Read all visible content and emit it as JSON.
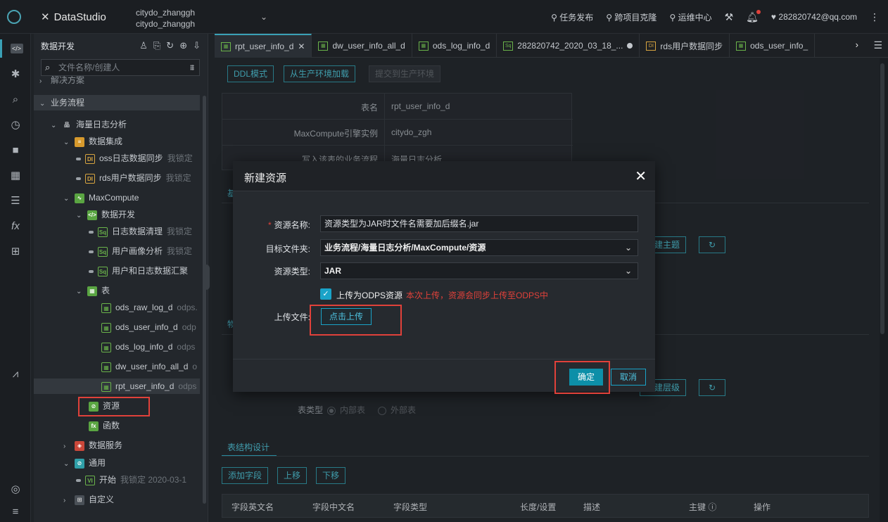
{
  "topbar": {
    "brand": "DataStudio",
    "user_line1": "citydo_zhanggh",
    "user_line2": "citydo_zhanggh",
    "nav": [
      "任务发布",
      "跨项目克隆",
      "运维中心"
    ],
    "account": "282820742@qq.com"
  },
  "sidebar": {
    "title": "数据开发",
    "search_placeholder": "文件名称/创建人",
    "rows": [
      {
        "label": "解决方案"
      },
      {
        "label": "业务流程"
      },
      {
        "label": "海量日志分析"
      },
      {
        "label": "数据集成"
      },
      {
        "icon": "DI",
        "label": "oss日志数据同步",
        "meta": "我锁定"
      },
      {
        "icon": "DI",
        "label": "rds用户数据同步",
        "meta": "我锁定"
      },
      {
        "label": "MaxCompute"
      },
      {
        "label": "数据开发"
      },
      {
        "icon": "Sq",
        "label": "日志数据清理",
        "meta": "我锁定"
      },
      {
        "icon": "Sq",
        "label": "用户画像分析",
        "meta": "我锁定"
      },
      {
        "icon": "Sq",
        "label": "用户和日志数据汇聚"
      },
      {
        "label": "表"
      },
      {
        "label": "ods_raw_log_d",
        "meta": "odps."
      },
      {
        "label": "ods_user_info_d",
        "meta": "odp"
      },
      {
        "label": "ods_log_info_d",
        "meta": "odps"
      },
      {
        "label": "dw_user_info_all_d",
        "meta": "o"
      },
      {
        "label": "rpt_user_info_d",
        "meta": "odps"
      },
      {
        "label": "资源"
      },
      {
        "label": "函数"
      },
      {
        "label": "数据服务"
      },
      {
        "label": "通用"
      },
      {
        "icon": "VI",
        "label": "开始",
        "meta": "我锁定 2020-03-1"
      },
      {
        "label": "自定义"
      }
    ]
  },
  "tabs": [
    {
      "label": "rpt_user_info_d",
      "icon": "table"
    },
    {
      "label": "dw_user_info_all_d",
      "icon": "table"
    },
    {
      "label": "ods_log_info_d",
      "icon": "table"
    },
    {
      "label": "282820742_2020_03_18_...",
      "icon": "Sq"
    },
    {
      "label": "rds用户数据同步",
      "icon": "DI"
    },
    {
      "label": "ods_user_info_",
      "icon": "table"
    }
  ],
  "editor": {
    "btn_ddl": "DDL模式",
    "btn_load": "从生产环境加载",
    "btn_submit": "提交到生产环境",
    "info": [
      {
        "label": "表名",
        "value": "rpt_user_info_d"
      },
      {
        "label": "MaxCompute引擎实例",
        "value": "citydo_zgh"
      },
      {
        "label": "写入该表的业务流程",
        "value": "海量日志分析"
      }
    ],
    "new_topic": "新建主题",
    "new_level": "新建层级",
    "table_type_label": "表类型",
    "internal": "内部表",
    "external": "外部表",
    "section_tab": "表结构设计",
    "add_field": "添加字段",
    "move_up": "上移",
    "move_down": "下移",
    "columns": [
      "字段英文名",
      "字段中文名",
      "字段类型",
      "长度/设置",
      "描述",
      "主键",
      "操作"
    ],
    "partial_a": "基",
    "partial_b": "物"
  },
  "modal": {
    "title": "新建资源",
    "name_label": "资源名称:",
    "name_value": "资源类型为JAR时文件名需要加后缀名.jar",
    "folder_label": "目标文件夹:",
    "folder_value": "业务流程/海量日志分析/MaxCompute/资源",
    "type_label": "资源类型:",
    "type_value": "JAR",
    "odps_label": "上传为ODPS资源",
    "odps_note": "本次上传，资源会同步上传至ODPS中",
    "upload_label": "上传文件:",
    "upload_btn": "点击上传",
    "ok": "确定",
    "cancel": "取消"
  }
}
